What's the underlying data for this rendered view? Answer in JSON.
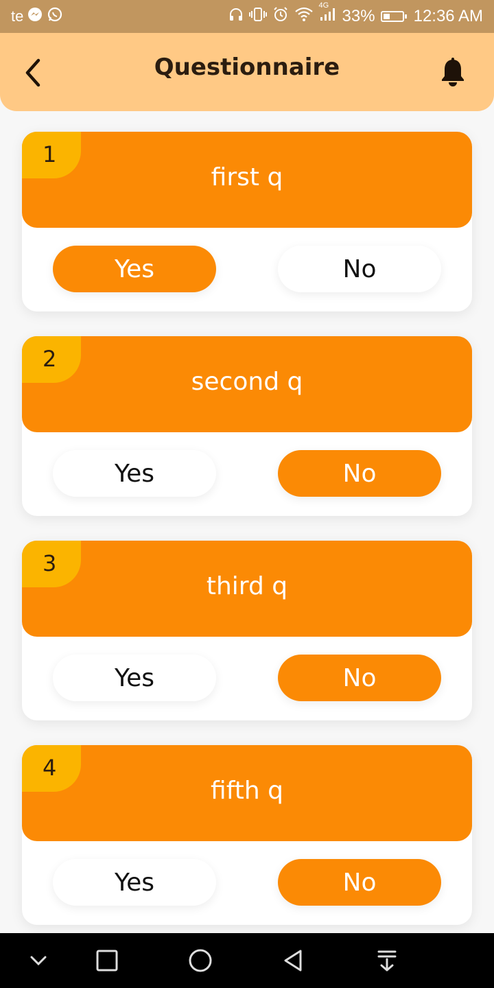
{
  "status_bar": {
    "carrier": "te",
    "network": "4G",
    "battery": "33%",
    "time": "12:36 AM",
    "left_icons": [
      "messenger-icon",
      "whatsapp-icon"
    ],
    "right_icons": [
      "headset-icon",
      "vibrate-icon",
      "alarm-icon",
      "wifi-icon",
      "signal-icon",
      "battery-icon"
    ]
  },
  "app_bar": {
    "title": "Questionnaire",
    "back_icon": "chevron-left-icon",
    "action_icon": "bell-icon"
  },
  "colors": {
    "accent": "#fb8a05",
    "badge": "#fbb400",
    "app_bar_bg": "#ffc985",
    "status_bar_bg": "#c1965f"
  },
  "questions": [
    {
      "number": "1",
      "text": "first q",
      "yes_label": "Yes",
      "no_label": "No",
      "selected": "yes"
    },
    {
      "number": "2",
      "text": "second q",
      "yes_label": "Yes",
      "no_label": "No",
      "selected": "no"
    },
    {
      "number": "3",
      "text": "third q",
      "yes_label": "Yes",
      "no_label": "No",
      "selected": "no"
    },
    {
      "number": "4",
      "text": "fifth q",
      "yes_label": "Yes",
      "no_label": "No",
      "selected": "no"
    }
  ],
  "nav_bar": {
    "icons": [
      "chevron-down-icon",
      "recents-square-icon",
      "home-circle-icon",
      "back-triangle-icon",
      "notification-pull-icon"
    ]
  }
}
